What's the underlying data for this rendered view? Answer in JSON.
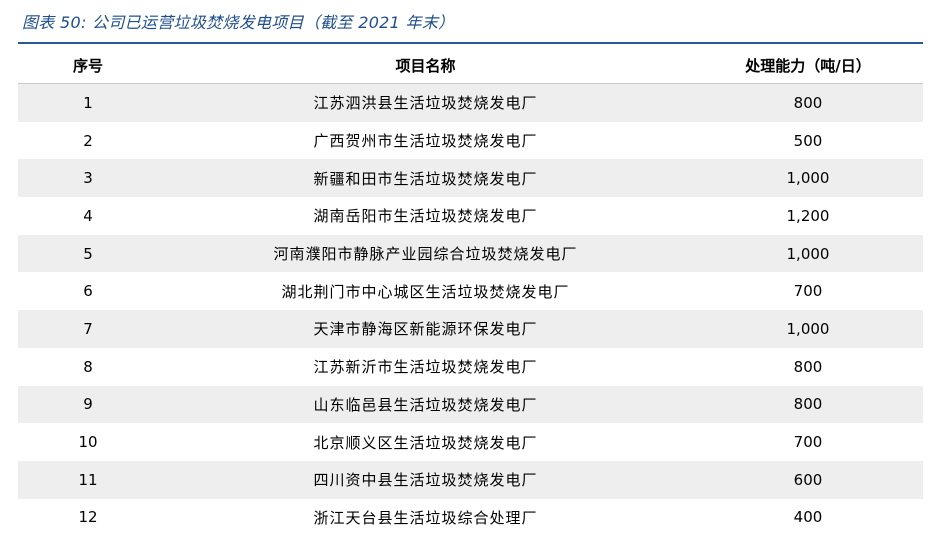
{
  "caption": "图表 50:  公司已运营垃圾焚烧发电项目（截至 2021 年末）",
  "table": {
    "headers": [
      "序号",
      "项目名称",
      "处理能力（吨/日）"
    ],
    "rows": [
      [
        "1",
        "江苏泗洪县生活垃圾焚烧发电厂",
        "800"
      ],
      [
        "2",
        "广西贺州市生活垃圾焚烧发电厂",
        "500"
      ],
      [
        "3",
        "新疆和田市生活垃圾焚烧发电厂",
        "1,000"
      ],
      [
        "4",
        "湖南岳阳市生活垃圾焚烧发电厂",
        "1,200"
      ],
      [
        "5",
        "河南濮阳市静脉产业园综合垃圾焚烧发电厂",
        "1,000"
      ],
      [
        "6",
        "湖北荆门市中心城区生活垃圾焚烧发电厂",
        "700"
      ],
      [
        "7",
        "天津市静海区新能源环保发电厂",
        "1,000"
      ],
      [
        "8",
        "江苏新沂市生活垃圾焚烧发电厂",
        "800"
      ],
      [
        "9",
        "山东临邑县生活垃圾焚烧发电厂",
        "800"
      ],
      [
        "10",
        "北京顺义区生活垃圾焚烧发电厂",
        "700"
      ],
      [
        "11",
        "四川资中县生活垃圾焚烧发电厂",
        "600"
      ],
      [
        "12",
        "浙江天台县生活垃圾综合处理厂",
        "400"
      ]
    ]
  },
  "colors": {
    "caption": "#1f4e8c",
    "rule": "#2b5797",
    "band": "#eeeeee"
  }
}
